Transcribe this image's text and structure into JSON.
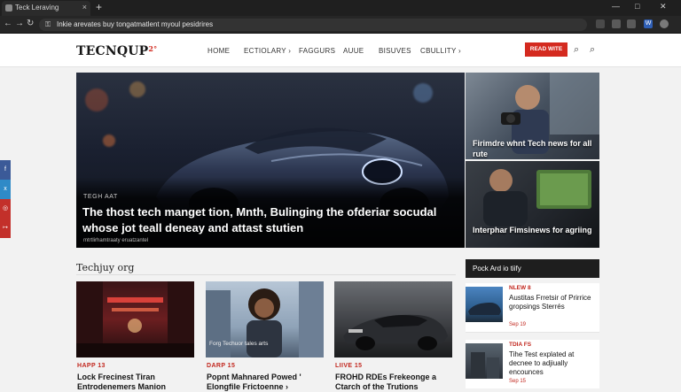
{
  "browser": {
    "tab_title": "Teck Leraving",
    "tab_close": "×",
    "tab_new": "+",
    "url": "Inkie arevates buy tongatmatlent myoul pesidrires",
    "win_min": "—",
    "win_max": "□",
    "win_close": "✕",
    "nav_back": "←",
    "nav_forward": "→",
    "nav_reload": "↻",
    "ext_label": "W"
  },
  "site": {
    "logo": "TECNQUP",
    "logo_sup": "2°",
    "nav": [
      "HOME",
      "ECTIOLARY ›",
      "FAGGURS",
      "AUUE",
      "BISUVES",
      "CBULLITY ›"
    ],
    "cta": "READ WITE",
    "search_glyph": "⌕",
    "search_glyph_2": "⌕"
  },
  "social": [
    {
      "glyph": "f",
      "color": "#3b5a98"
    },
    {
      "glyph": "x",
      "color": "#2f8ac7"
    },
    {
      "glyph": "◎",
      "color": "#c3302a"
    },
    {
      "glyph": "↦",
      "color": "#c3302a"
    }
  ],
  "hero": {
    "kicker": "TEGH AAT",
    "title": "The thost tech manget tion, Mnth, Bulinging the ofderiar socudal whose jot teall deneay and attast stutien",
    "byline": "mtrtlirhamtraaty eruatzantel"
  },
  "side_features": [
    {
      "text": "Firimdre whnt Tech news for all rute"
    },
    {
      "text": "Interphar Fimsinews for agriing"
    }
  ],
  "section": {
    "title": "Techjuy org"
  },
  "cards": [
    {
      "category": "HAPP 13",
      "title": "Lock Frecinest Tiran Entrodenemers Manion",
      "caption": ""
    },
    {
      "category": "DARP 15",
      "title": "Popnt Mahnared Powed ' Elongfile Frictoenne ›",
      "caption": "Forg Techuor tales arts"
    },
    {
      "category": "LIIVE 15",
      "title": "FROHD RDEs Frekeonge a Ctarch of the Trutions",
      "caption": ""
    }
  ],
  "rail": {
    "heading": "Pock Ard io tiify",
    "items": [
      {
        "tag": "NLEW 8",
        "title": "Austitas Frretsir of Prirrice gropsings Sterrés",
        "date": "Sep 19"
      },
      {
        "tag": "TDIA FS",
        "title": "Tihe Test explated at decnee to adjiually encounces",
        "date": "Sep 15"
      }
    ]
  }
}
